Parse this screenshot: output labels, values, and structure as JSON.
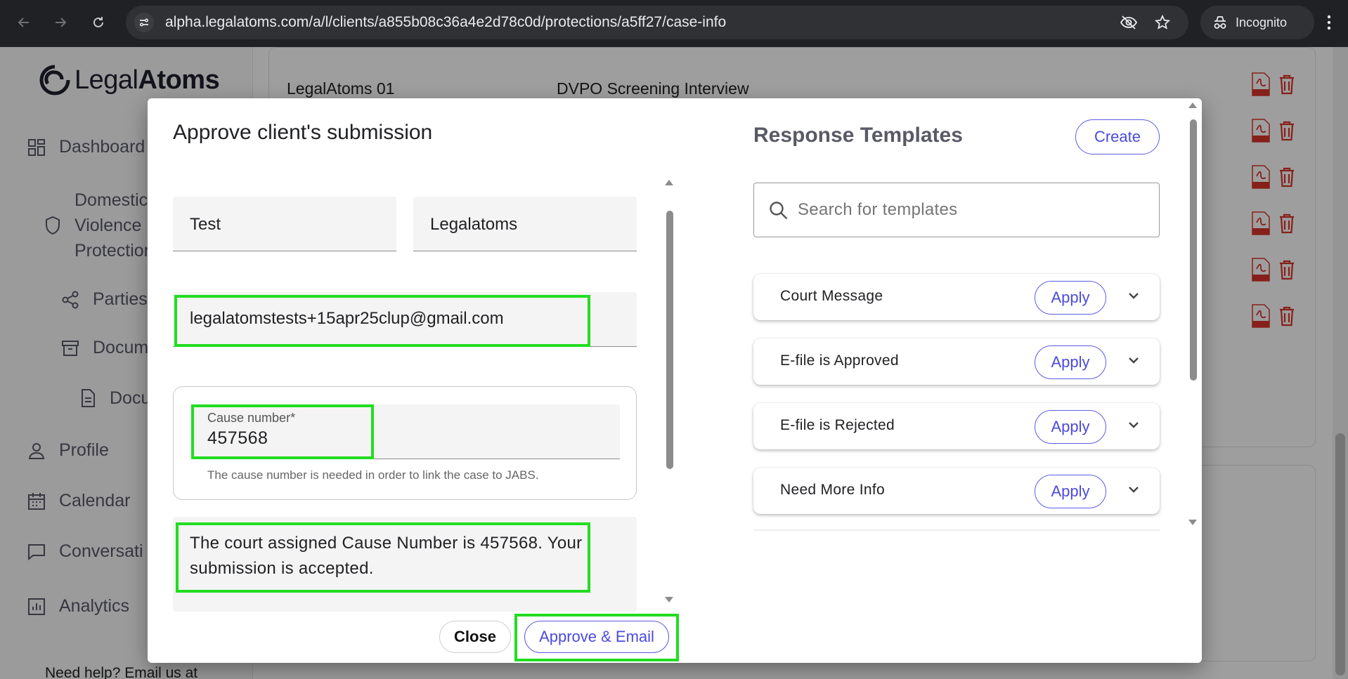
{
  "browser": {
    "url": "alpha.legalatoms.com/a/l/clients/a855b08c36a4e2d78c0d/protections/a5ff27/case-info",
    "incognito_label": "Incognito"
  },
  "app": {
    "logo_text_1": "Legal",
    "logo_text_2": "Atoms",
    "sidebar": {
      "dashboard": "Dashboard",
      "domestic_1": "Domestic",
      "domestic_2": "Violence",
      "domestic_3": "Protection",
      "parties": "Parties",
      "documents": "Docum",
      "docs_sub": "Docu",
      "profile": "Profile",
      "calendar": "Calendar",
      "conversations": "Conversati",
      "analytics": "Analytics"
    },
    "row_client": "LegalAtoms 01",
    "row_interview": "DVPO Screening Interview",
    "help_text": "Need help? Email us at"
  },
  "dialog": {
    "title": "Approve client's submission",
    "first_name": "Test",
    "last_name": "Legalatoms",
    "email": "legalatomstests+15apr25clup@gmail.com",
    "cause_label": "Cause number*",
    "cause_value": "457568",
    "cause_hint": "The cause number is needed in order to link the case to JABS.",
    "message": "The court assigned Cause Number is 457568. Your submission is accepted.",
    "close_label": "Close",
    "approve_label": "Approve & Email"
  },
  "templates": {
    "title": "Response Templates",
    "create_label": "Create",
    "search_placeholder": "Search for templates",
    "apply_label": "Apply",
    "items": [
      {
        "name": "Court Message"
      },
      {
        "name": "E-file is Approved"
      },
      {
        "name": "E-file is Rejected"
      },
      {
        "name": "Need More Info"
      }
    ]
  },
  "colors": {
    "accent": "#4a4ae0",
    "highlight": "#22dd22",
    "pdf_red": "#d9342b"
  }
}
